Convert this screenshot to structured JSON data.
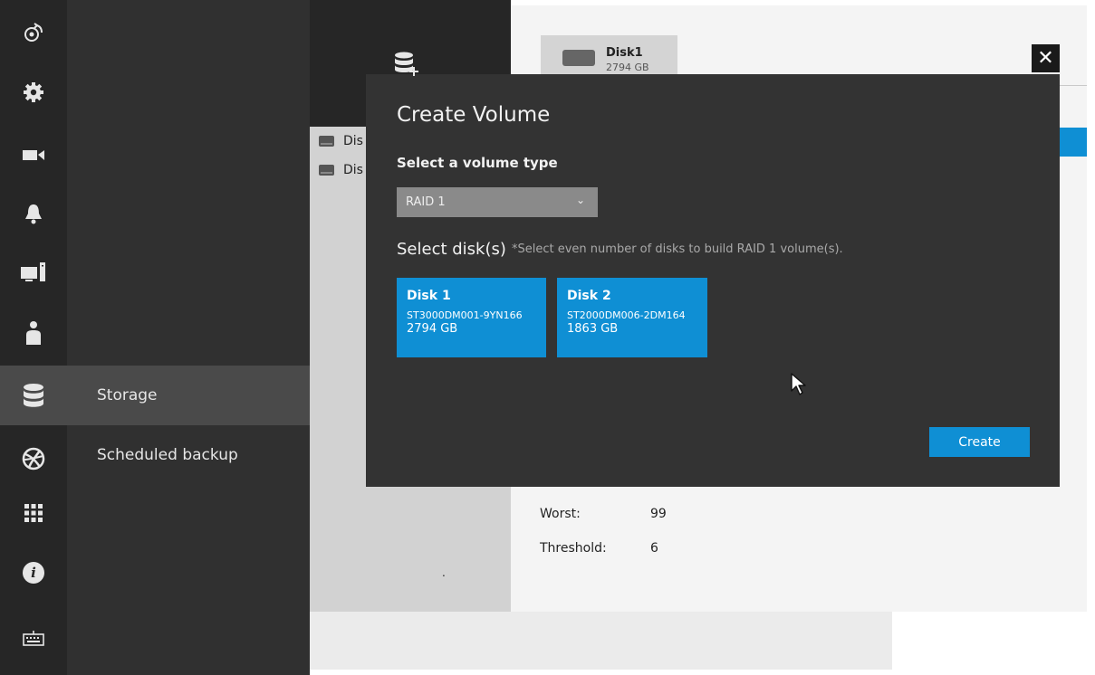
{
  "rail": {
    "icons": [
      "remote-icon",
      "gear-icon",
      "camera-icon",
      "bell-icon",
      "computer-icon",
      "person-icon",
      "database-icon",
      "globe-icon",
      "grid-icon",
      "info-icon",
      "keyboard-icon"
    ],
    "info_glyph": "i"
  },
  "nav": {
    "items": [
      {
        "label": "Storage"
      },
      {
        "label": "Scheduled backup"
      }
    ]
  },
  "storage": {
    "disk_list": [
      {
        "label": "Dis"
      },
      {
        "label": "Dis"
      }
    ],
    "disk_tab": {
      "name": "Disk1",
      "size": "2794 GB"
    },
    "details": [
      {
        "label": "Worst:",
        "value": "99"
      },
      {
        "label": "Threshold:",
        "value": "6"
      }
    ],
    "dot": "."
  },
  "modal": {
    "close_glyph": "✕",
    "title": "Create Volume",
    "volume_type_label": "Select a volume type",
    "volume_type_value": "RAID 1",
    "chevron_glyph": "⌄",
    "disks_label": "Select disk(s)",
    "disks_hint": "*Select even number of disks to build RAID 1 volume(s).",
    "disks": [
      {
        "name": "Disk 1",
        "model": "ST3000DM001-9YN166",
        "size": "2794 GB"
      },
      {
        "name": "Disk 2",
        "model": "ST2000DM006-2DM164",
        "size": "1863 GB"
      }
    ],
    "create_label": "Create"
  },
  "colors": {
    "accent": "#0f8fd4",
    "modal_bg": "#333333",
    "rail_bg": "#262626",
    "nav_bg": "#303030",
    "active_bg": "#4a4a4a"
  }
}
